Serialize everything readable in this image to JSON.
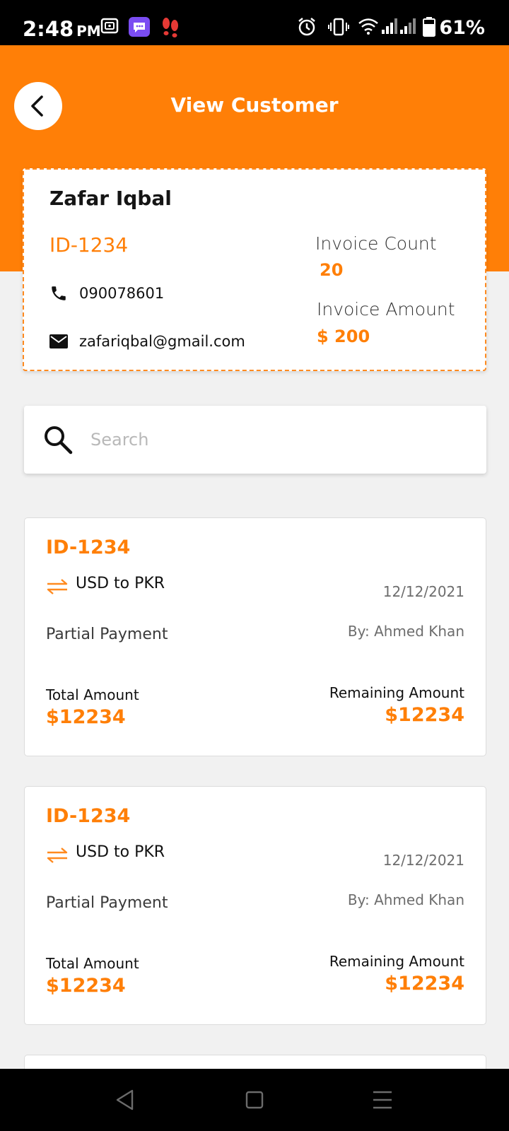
{
  "status_bar": {
    "time": "2:48",
    "ampm": "PM",
    "battery_percent": "61%"
  },
  "header": {
    "title": "View Customer",
    "background_color": "#ff7f07"
  },
  "customer": {
    "name": "Zafar Iqbal",
    "id": "ID-1234",
    "phone": "090078601",
    "email": "zafariqbal@gmail.com",
    "invoice_count_label": "Invoice Count",
    "invoice_count": "20",
    "invoice_amount_label": "Invoice Amount",
    "invoice_amount": "$ 200"
  },
  "search": {
    "placeholder": "Search"
  },
  "invoices": [
    {
      "id": "ID-1234",
      "currency": "USD to PKR",
      "date": "12/12/2021",
      "type": "Partial Payment",
      "by": "By: Ahmed Khan",
      "total_label": "Total Amount",
      "total": "$12234",
      "remaining_label": "Remaining Amount",
      "remaining": "$12234"
    },
    {
      "id": "ID-1234",
      "currency": "USD to PKR",
      "date": "12/12/2021",
      "type": "Partial Payment",
      "by": "By: Ahmed Khan",
      "total_label": "Total Amount",
      "total": "$12234",
      "remaining_label": "Remaining Amount",
      "remaining": "$12234"
    }
  ],
  "icons": {
    "back": "chevron-left-icon",
    "phone": "phone-icon",
    "email": "mail-icon",
    "search": "search-icon",
    "exchange": "exchange-arrows-icon"
  }
}
